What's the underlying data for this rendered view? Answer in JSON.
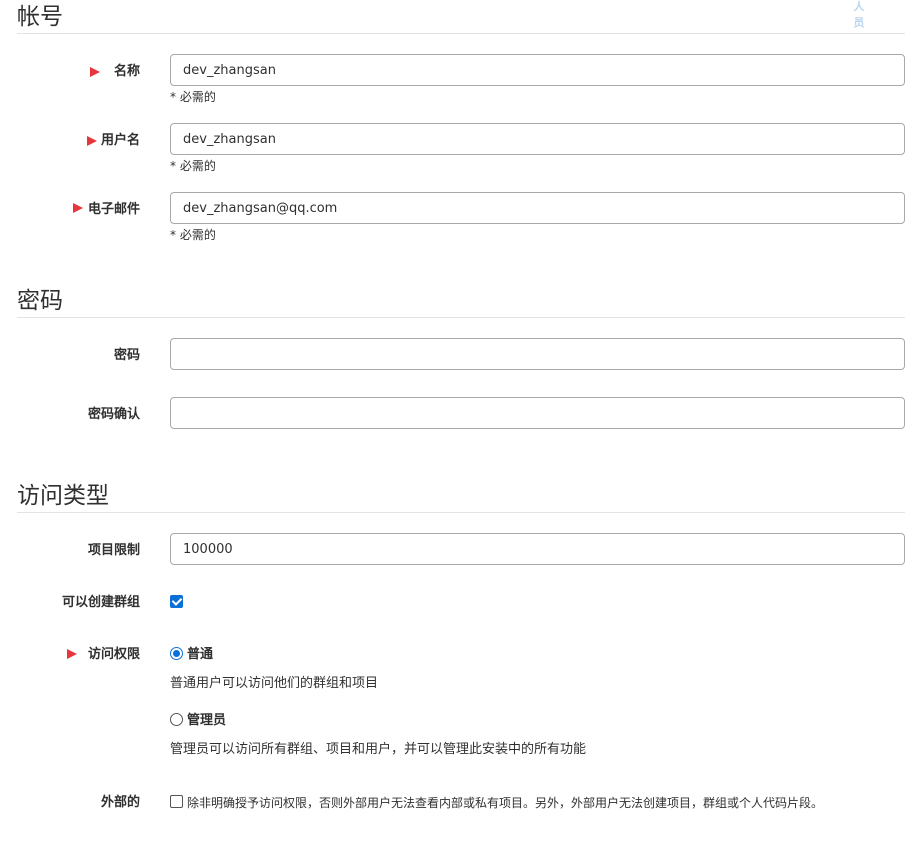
{
  "corner_label": "人员",
  "account": {
    "title": "帐号",
    "name": {
      "label": "名称",
      "value": "dev_zhangsan",
      "help": "* 必需的"
    },
    "username": {
      "label": "用户名",
      "value": "dev_zhangsan",
      "help": "* 必需的"
    },
    "email": {
      "label": "电子邮件",
      "value": "dev_zhangsan@qq.com",
      "help": "* 必需的"
    }
  },
  "password": {
    "title": "密码",
    "password": {
      "label": "密码",
      "value": ""
    },
    "confirm": {
      "label": "密码确认",
      "value": ""
    }
  },
  "access": {
    "title": "访问类型",
    "projects_limit": {
      "label": "项目限制",
      "value": "100000"
    },
    "can_create_group": {
      "label": "可以创建群组",
      "checked": true
    },
    "access_level": {
      "label": "访问权限",
      "options": [
        {
          "label": "普通",
          "description": "普通用户可以访问他们的群组和项目",
          "selected": true
        },
        {
          "label": "管理员",
          "description": "管理员可以访问所有群组、项目和用户，并可以管理此安装中的所有功能",
          "selected": false
        }
      ]
    },
    "external": {
      "label": "外部的",
      "checked": false,
      "description": "除非明确授予访问权限，否则外部用户无法查看内部或私有项目。另外，外部用户无法创建项目，群组或个人代码片段。"
    }
  },
  "colors": {
    "required_arrow": "#e8343b",
    "accent": "#0b6fd8",
    "corner_text": "#bcd6ee"
  }
}
